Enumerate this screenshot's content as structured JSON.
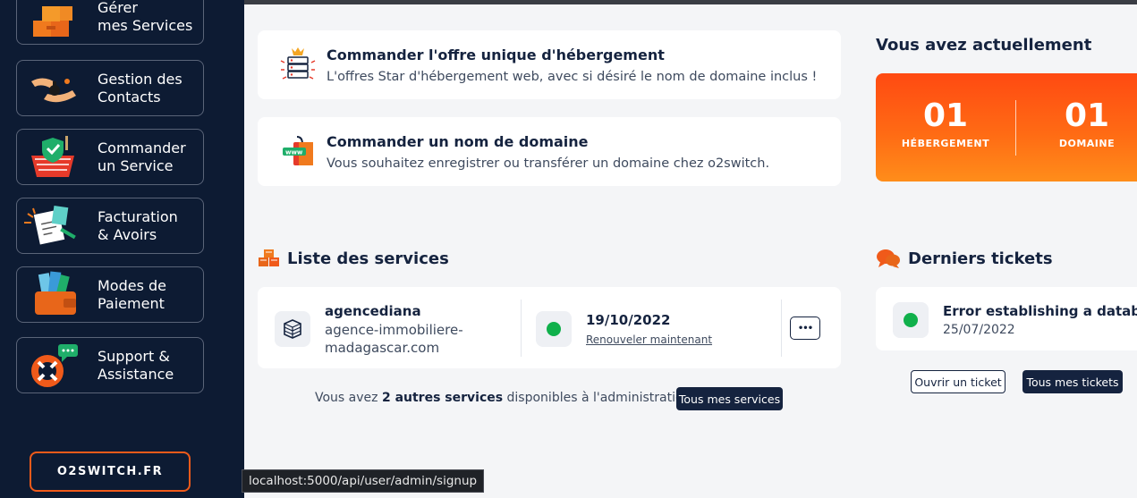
{
  "sidebar": {
    "items": [
      {
        "label": "Gérer\nmes Services",
        "icon": "boxes-icon"
      },
      {
        "label": "Gestion des\nContacts",
        "icon": "handshake-icon"
      },
      {
        "label": "Commander\nun Service",
        "icon": "shopping-basket-icon"
      },
      {
        "label": "Facturation\n& Avoirs",
        "icon": "invoice-icon"
      },
      {
        "label": "Modes de\nPaiement",
        "icon": "wallet-icon"
      },
      {
        "label": "Support &\nAssistance",
        "icon": "lifebuoy-icon"
      }
    ],
    "brand_button": "O2SWITCH.FR"
  },
  "offers": [
    {
      "title": "Commander l'offre unique d'hébergement",
      "desc": "L'offres Star d'hébergement web, avec si désiré le nom de domaine inclus !",
      "icon": "server-crown-icon"
    },
    {
      "title": "Commander un nom de domaine",
      "desc": "Vous souhaitez enregistrer ou transférer un domaine chez o2switch.",
      "icon": "www-bag-icon"
    }
  ],
  "summary": {
    "title": "Vous avez actuellement",
    "hosting_count": "01",
    "hosting_label": "HÉBERGEMENT",
    "domain_count": "01",
    "domain_label": "DOMAINE"
  },
  "services": {
    "title": "Liste des services",
    "item": {
      "name": "agencediana",
      "domain": "agence-immobiliere-\nmadagascar.com",
      "date": "19/10/2022",
      "renew": "Renouveler maintenant",
      "status_color": "#10b04b"
    },
    "footer_prefix": "Vous avez ",
    "footer_bold": "2 autres services",
    "footer_suffix": " disponibles à l'administration",
    "all_button": "Tous mes services",
    "more_glyph": "•••"
  },
  "tickets": {
    "title": "Derniers tickets",
    "item": {
      "subject": "Error establishing a datab ...",
      "date": "25/07/2022"
    },
    "open_button": "Ouvrir un ticket",
    "all_button": "Tous mes tickets"
  },
  "status_bar": {
    "url": "localhost:5000/api/user/admin/signup"
  },
  "colors": {
    "sidebar": "#0d1b33",
    "accent": "#f05a1a",
    "navy": "#15233f",
    "success": "#10b04b"
  }
}
